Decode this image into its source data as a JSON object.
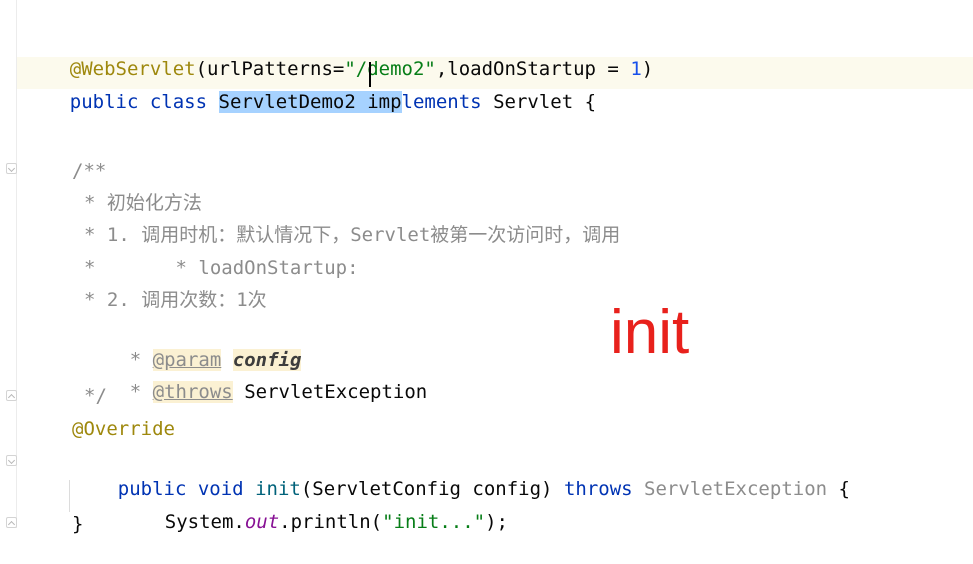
{
  "editor": {
    "lines": {
      "l1": {
        "annotation": "@WebServlet",
        "open": "(urlPatterns=",
        "str": "\"/demo2\"",
        "mid": ",loadOnStartup = ",
        "num": "1",
        "close": ")"
      },
      "l2": {
        "kw1": "public",
        "kw2": "class",
        "sel": "ServletDemo2 imp",
        "rest_kw": "lements",
        "type": "Servlet",
        "brace": "{"
      },
      "l3": "/**",
      "l4": "* 初始化方法",
      "l5": "* 1. 调用时机：默认情况下，Servlet被第一次访问时，调用",
      "l6": "*       * loadOnStartup:",
      "l7": "* 2. 调用次数：1次",
      "l8": {
        "star": "* ",
        "tag": "@param",
        "sp": " ",
        "param": "config"
      },
      "l9": {
        "star": "* ",
        "tag": "@throws",
        "sp": " ",
        "type": "ServletException"
      },
      "l10": "*/",
      "l11": "@Override",
      "l12": {
        "kw1": "public",
        "kw2": "void",
        "method": "init",
        "sig": "(ServletConfig config) ",
        "kw3": "throws",
        "exc": "ServletException",
        "brace": " {"
      },
      "l13": {
        "pre": "System.",
        "field": "out",
        "mid": ".println(",
        "str": "\"init...\"",
        "end": ");"
      },
      "l14": "}"
    }
  },
  "overlay": {
    "text": "init",
    "color": "#e8211c"
  },
  "colors": {
    "keyword": "#0033b3",
    "string": "#067d17",
    "annotation": "#9e880d",
    "comment": "#8c8c8c",
    "selection": "#a6d2ff",
    "method": "#00627a"
  }
}
